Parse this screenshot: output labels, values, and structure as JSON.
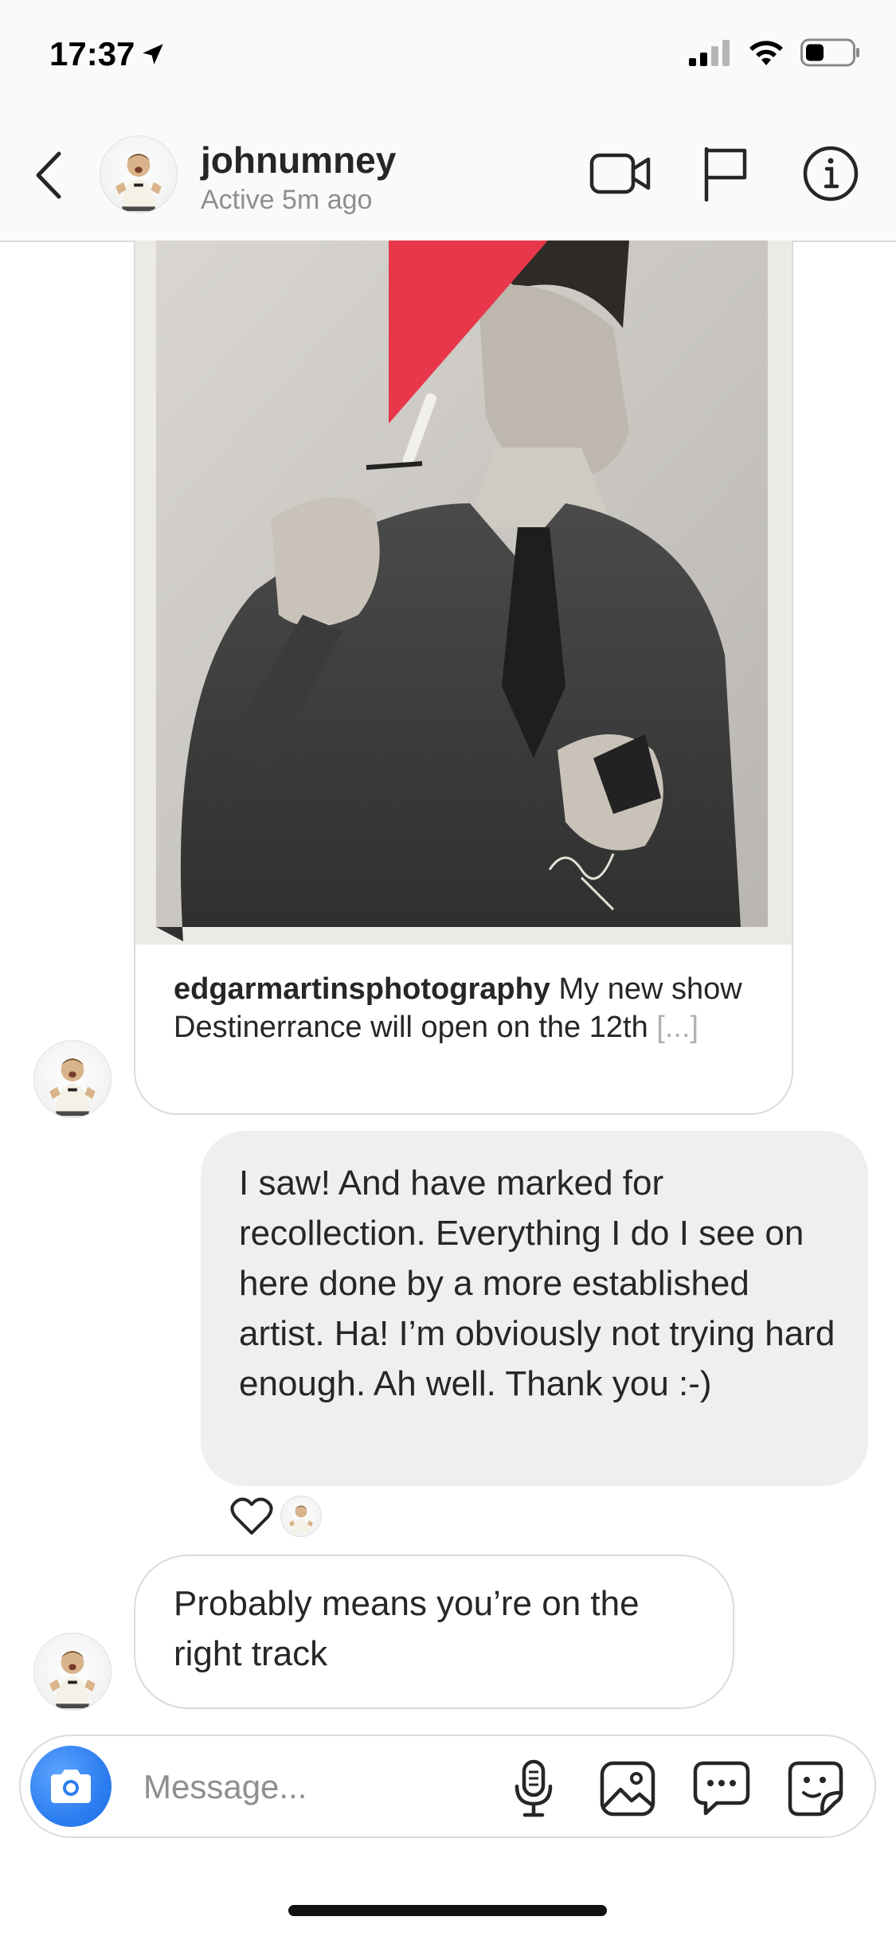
{
  "status_bar": {
    "time": "17:37",
    "icons": [
      "location-arrow-icon",
      "cellular-signal-icon",
      "wifi-icon",
      "battery-icon"
    ]
  },
  "header": {
    "username": "johnumney",
    "activity": "Active 5m ago",
    "actions": [
      "video-call-icon",
      "flag-icon",
      "info-icon"
    ]
  },
  "shared_post": {
    "author": "edgarmartinsphotography",
    "caption": "My new show Destinerrance will open on the 12th",
    "more": "[...]"
  },
  "messages": [
    {
      "direction": "outgoing",
      "text": "I saw! And have marked for recollection. Everything I do I see on here done by a more established artist. Ha! I’m obviously not trying hard enough. Ah well. Thank you :-)"
    },
    {
      "direction": "incoming",
      "text": "Probably means you’re on the right track"
    }
  ],
  "composer": {
    "placeholder": "Message...",
    "actions": [
      "microphone-icon",
      "gallery-icon",
      "chat-bubble-icon",
      "sticker-icon"
    ]
  },
  "colors": {
    "accent_red": "#e8374b",
    "camera_blue": "#2d7ef0",
    "bubble_grey": "#efefef",
    "border": "#dbdbdb",
    "secondary_text": "#8e8e8e"
  }
}
